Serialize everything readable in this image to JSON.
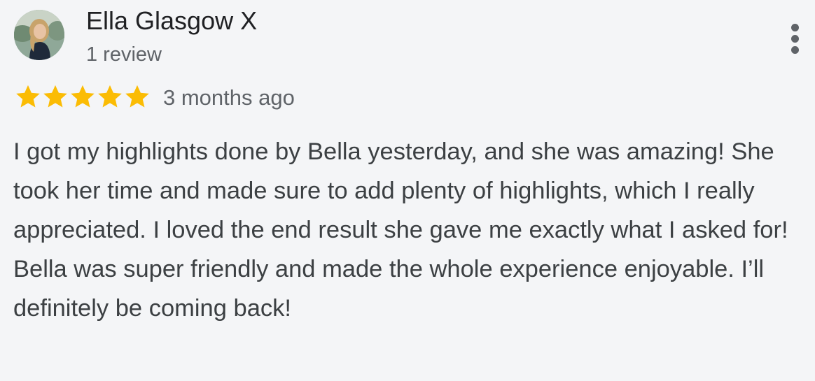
{
  "reviewer": {
    "name": "Ella Glasgow X",
    "review_count": "1 review",
    "avatar_icon": "profile-photo"
  },
  "rating": {
    "stars": 5,
    "max_stars": 5,
    "star_color": "#fbbc04"
  },
  "review": {
    "time_ago": "3 months ago",
    "text": "I got my highlights done by Bella yesterday, and she was amazing! She took her time and made sure to add plenty of highlights, which I really appreciated. I loved the end result she gave me exactly what I asked for! Bella was super friendly and made the whole experience enjoyable. I’ll definitely be coming back!"
  },
  "actions": {
    "more_icon": "more-vert-icon"
  }
}
